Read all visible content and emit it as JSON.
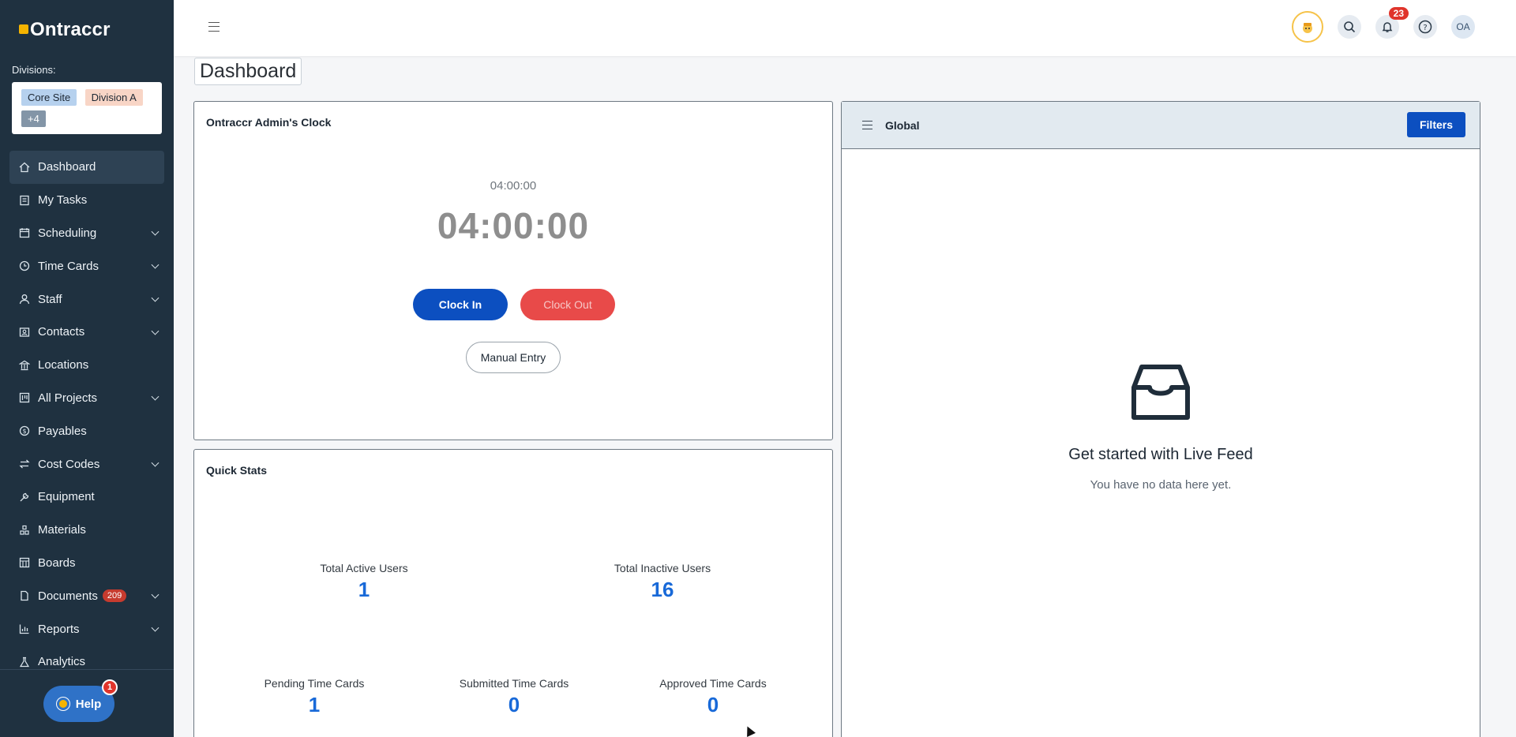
{
  "app": {
    "logo_text": "Ontraccr"
  },
  "sidebar": {
    "divisions_label": "Divisions:",
    "divisions": [
      "Core Site",
      "Division A",
      "+4"
    ],
    "items": [
      {
        "label": "Dashboard",
        "icon": "home-icon",
        "expandable": false,
        "active": true
      },
      {
        "label": "My Tasks",
        "icon": "tasks-icon",
        "expandable": false
      },
      {
        "label": "Scheduling",
        "icon": "calendar-icon",
        "expandable": true
      },
      {
        "label": "Time Cards",
        "icon": "clock-icon",
        "expandable": true
      },
      {
        "label": "Staff",
        "icon": "user-icon",
        "expandable": true
      },
      {
        "label": "Contacts",
        "icon": "contacts-icon",
        "expandable": true
      },
      {
        "label": "Locations",
        "icon": "building-icon",
        "expandable": false
      },
      {
        "label": "All Projects",
        "icon": "projects-icon",
        "expandable": true
      },
      {
        "label": "Payables",
        "icon": "dollar-icon",
        "expandable": false
      },
      {
        "label": "Cost Codes",
        "icon": "swap-icon",
        "expandable": true
      },
      {
        "label": "Equipment",
        "icon": "tool-icon",
        "expandable": false
      },
      {
        "label": "Materials",
        "icon": "materials-icon",
        "expandable": false
      },
      {
        "label": "Boards",
        "icon": "board-icon",
        "expandable": false
      },
      {
        "label": "Documents",
        "icon": "document-icon",
        "expandable": true,
        "count": "209"
      },
      {
        "label": "Reports",
        "icon": "chart-icon",
        "expandable": true
      },
      {
        "label": "Analytics",
        "icon": "analytics-icon",
        "expandable": false
      }
    ],
    "help": {
      "label": "Help",
      "badge": "1"
    }
  },
  "topbar": {
    "notifications_count": "23",
    "avatar_initials": "OA"
  },
  "page": {
    "title": "Dashboard"
  },
  "clock_card": {
    "title": "Ontraccr Admin's Clock",
    "time_small": "04:00:00",
    "time_big": "04:00:00",
    "clock_in_label": "Clock In",
    "clock_out_label": "Clock Out",
    "manual_entry_label": "Manual Entry"
  },
  "stats_card": {
    "title": "Quick Stats",
    "stats": [
      {
        "label": "Total Active Users",
        "value": "1"
      },
      {
        "label": "Total Inactive Users",
        "value": "16"
      },
      {
        "label": "Pending Time Cards",
        "value": "1"
      },
      {
        "label": "Submitted Time Cards",
        "value": "0"
      },
      {
        "label": "Approved Time Cards",
        "value": "0"
      }
    ]
  },
  "feed_card": {
    "title": "Global",
    "filters_label": "Filters",
    "empty_title": "Get started with Live Feed",
    "empty_subtitle": "You have no data here yet."
  },
  "colors": {
    "sidebar_bg": "#1f3140",
    "primary": "#0c4fc0",
    "danger": "#e84a49",
    "stat_value": "#1869d8",
    "badge": "#e0342b"
  }
}
